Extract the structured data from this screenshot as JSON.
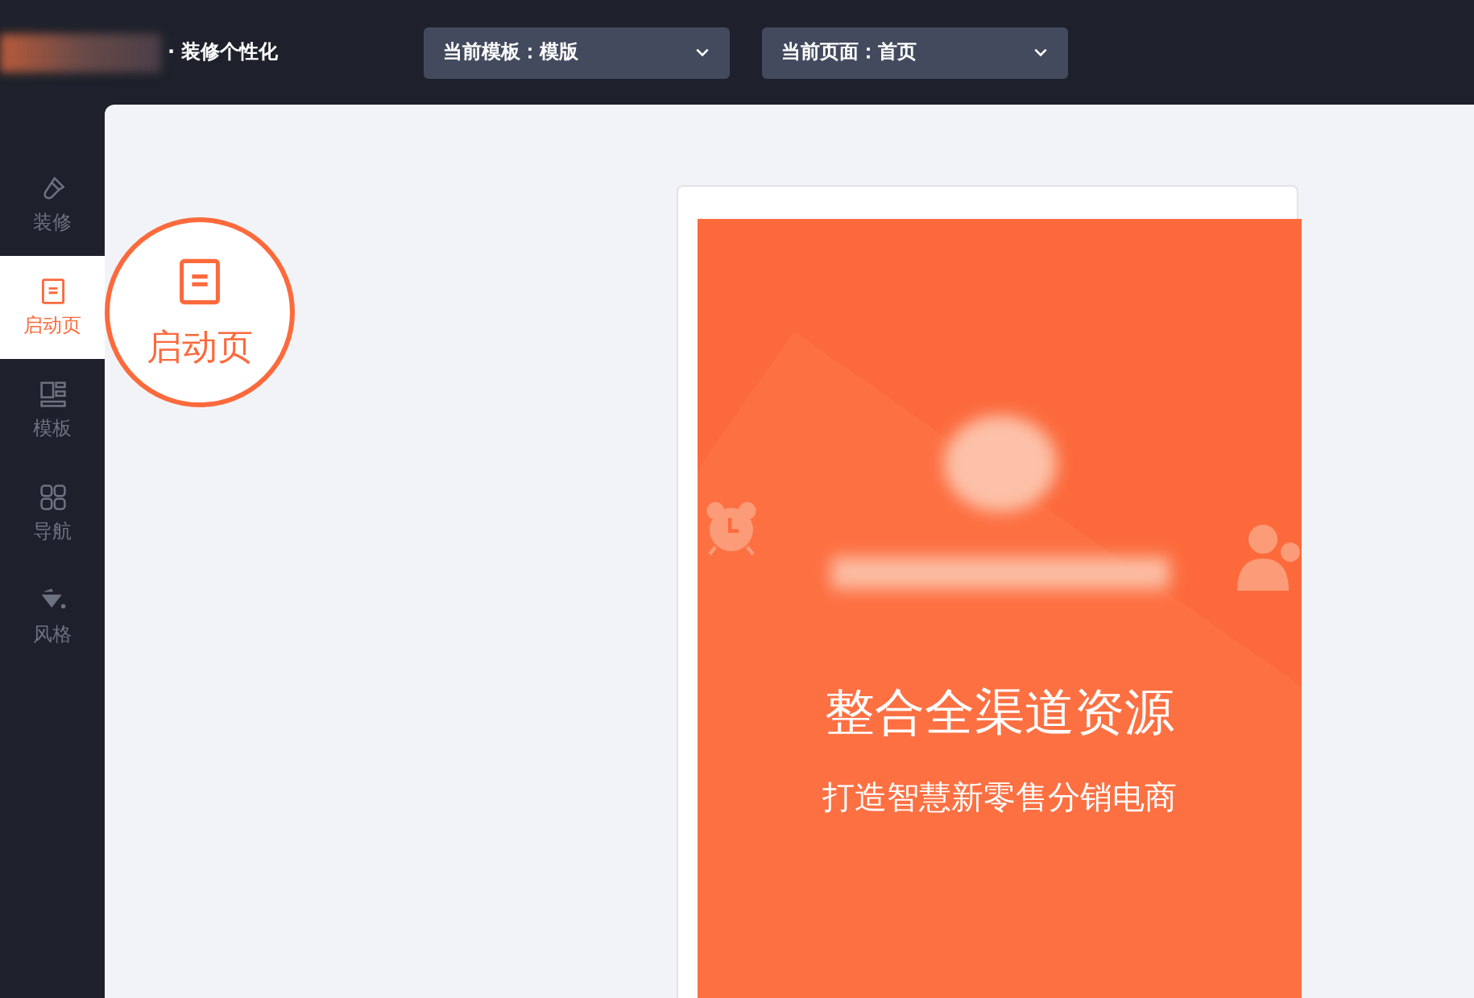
{
  "header": {
    "title": "· 装修个性化",
    "dropdowns": [
      {
        "label": "当前模板：模版"
      },
      {
        "label": "当前页面：首页"
      }
    ]
  },
  "sidebar": {
    "items": [
      {
        "label": "装修",
        "kind": "brush",
        "selected": false
      },
      {
        "label": "启动页",
        "kind": "page",
        "selected": true
      },
      {
        "label": "模板",
        "kind": "template",
        "selected": false
      },
      {
        "label": "导航",
        "kind": "grid",
        "selected": false
      },
      {
        "label": "风格",
        "kind": "bucket",
        "selected": false
      }
    ]
  },
  "callout": {
    "label": "启动页"
  },
  "preview": {
    "headline": "整合全渠道资源",
    "subline": "打造智慧新零售分销电商"
  }
}
